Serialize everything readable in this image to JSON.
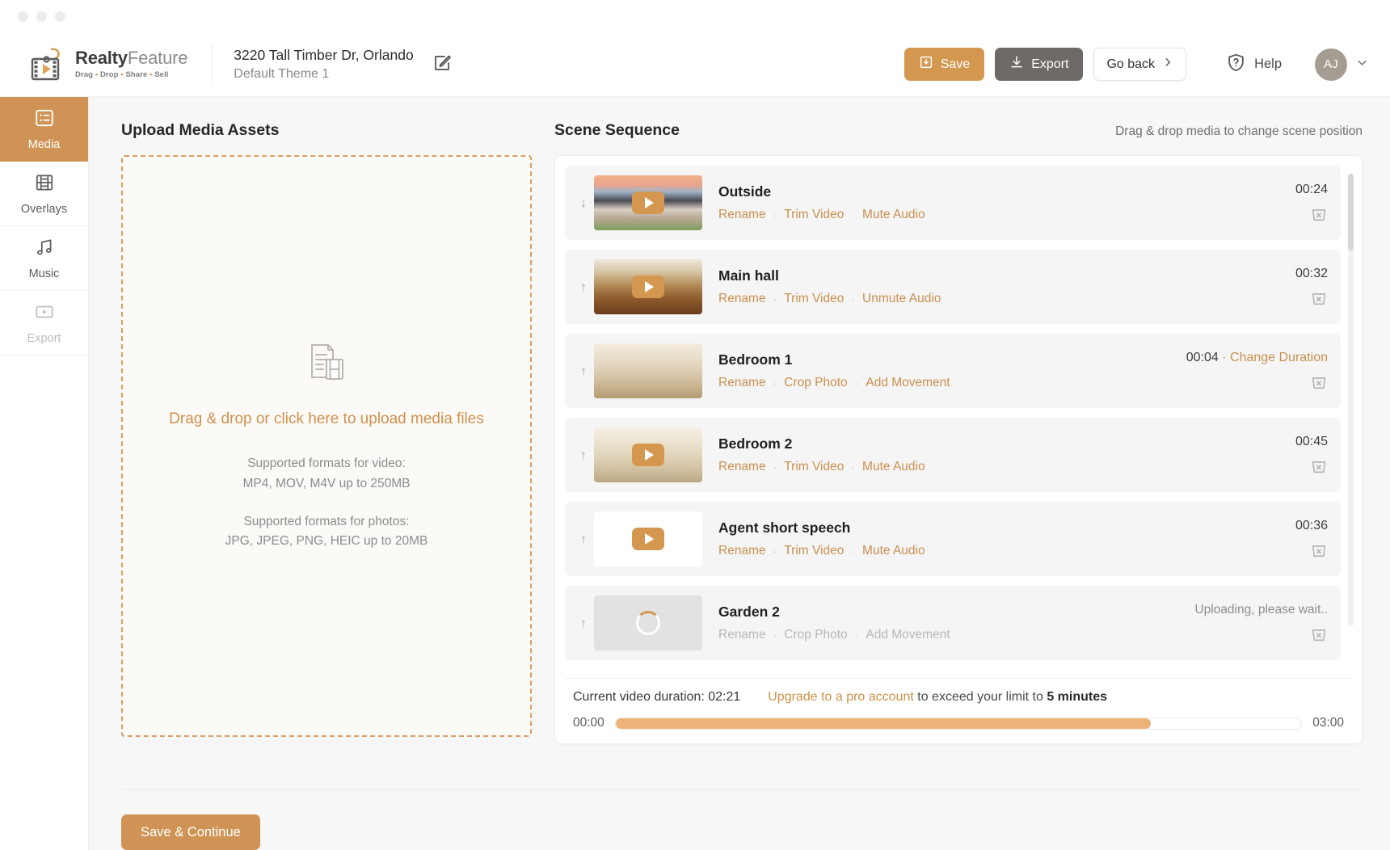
{
  "brand": {
    "name_bold": "Realty",
    "name_light": "Feature",
    "tagline_parts": [
      "Drag",
      "Drop",
      "Share",
      "Sell"
    ],
    "tagline": "Drag • Drop • Share • Sell"
  },
  "header": {
    "project_title": "3220 Tall Timber Dr, Orlando",
    "project_theme": "Default Theme 1",
    "edit_icon": "pencil-square-icon",
    "save_label": "Save",
    "save_icon": "save-download-icon",
    "export_label": "Export",
    "export_icon": "download-icon",
    "goback_label": "Go back",
    "goback_icon": "chevron-right-icon",
    "help_label": "Help",
    "help_icon": "shield-question-icon",
    "avatar_initials": "AJ",
    "avatar_chevron": "chevron-down-icon",
    "accent_color": "#d4974f",
    "export_color": "#6f6a65"
  },
  "sidebar": {
    "items": [
      {
        "label": "Media",
        "icon": "list-box-icon",
        "active": true,
        "disabled": false
      },
      {
        "label": "Overlays",
        "icon": "film-strip-icon",
        "active": false,
        "disabled": false
      },
      {
        "label": "Music",
        "icon": "music-note-icon",
        "active": false,
        "disabled": false
      },
      {
        "label": "Export",
        "icon": "video-box-icon",
        "active": false,
        "disabled": true
      }
    ]
  },
  "upload": {
    "title": "Upload Media Assets",
    "icon": "document-filmstrip-icon",
    "cta": "Drag & drop or click here to upload media files",
    "video_formats_label": "Supported formats for video:",
    "video_formats_value": "MP4, MOV, M4V up to 250MB",
    "photo_formats_label": "Supported formats for photos:",
    "photo_formats_value": "JPG, JPEG, PNG, HEIC up to 20MB"
  },
  "scenes": {
    "title": "Scene Sequence",
    "hint": "Drag & drop media to change scene position",
    "delete_icon": "trash-x-icon",
    "items": [
      {
        "name": "Outside",
        "drag_icon": "arrow-down-icon",
        "thumb_type": "photo-exterior",
        "has_play": true,
        "duration": "00:24",
        "status": "",
        "change_duration": "",
        "actions": [
          "Rename",
          "Trim Video",
          "Mute Audio"
        ],
        "disabled": false
      },
      {
        "name": "Main hall",
        "drag_icon": "arrow-up-icon",
        "thumb_type": "photo-interior",
        "has_play": true,
        "duration": "00:32",
        "status": "",
        "change_duration": "",
        "actions": [
          "Rename",
          "Trim Video",
          "Unmute Audio"
        ],
        "disabled": false
      },
      {
        "name": "Bedroom 1",
        "drag_icon": "arrow-up-icon",
        "thumb_type": "photo-bedroom1",
        "has_play": false,
        "duration": "00:04",
        "status": "",
        "change_duration": "Change Duration",
        "actions": [
          "Rename",
          "Crop Photo",
          "Add Movement"
        ],
        "disabled": false
      },
      {
        "name": "Bedroom 2",
        "drag_icon": "arrow-up-icon",
        "thumb_type": "photo-bedroom2",
        "has_play": true,
        "duration": "00:45",
        "status": "",
        "change_duration": "",
        "actions": [
          "Rename",
          "Trim Video",
          "Mute Audio"
        ],
        "disabled": false
      },
      {
        "name": "Agent short speech",
        "drag_icon": "arrow-up-icon",
        "thumb_type": "blank-white",
        "has_play": true,
        "duration": "00:36",
        "status": "",
        "change_duration": "",
        "actions": [
          "Rename",
          "Trim Video",
          "Mute Audio"
        ],
        "disabled": false
      },
      {
        "name": "Garden 2",
        "drag_icon": "arrow-up-icon",
        "thumb_type": "uploading",
        "has_play": false,
        "duration": "",
        "status": "Uploading, please wait..",
        "change_duration": "",
        "actions": [
          "Rename",
          "Crop Photo",
          "Add Movement"
        ],
        "disabled": true
      }
    ]
  },
  "duration": {
    "current_label": "Current video duration: 02:21",
    "upgrade_link": "Upgrade to a pro account",
    "upgrade_rest_before": " to exceed your limit to ",
    "upgrade_rest_bold": "5 minutes",
    "start": "00:00",
    "end": "03:00",
    "fill_percent": 78,
    "fill_color": "#edb277"
  },
  "footer": {
    "continue_label": "Save & Continue"
  }
}
